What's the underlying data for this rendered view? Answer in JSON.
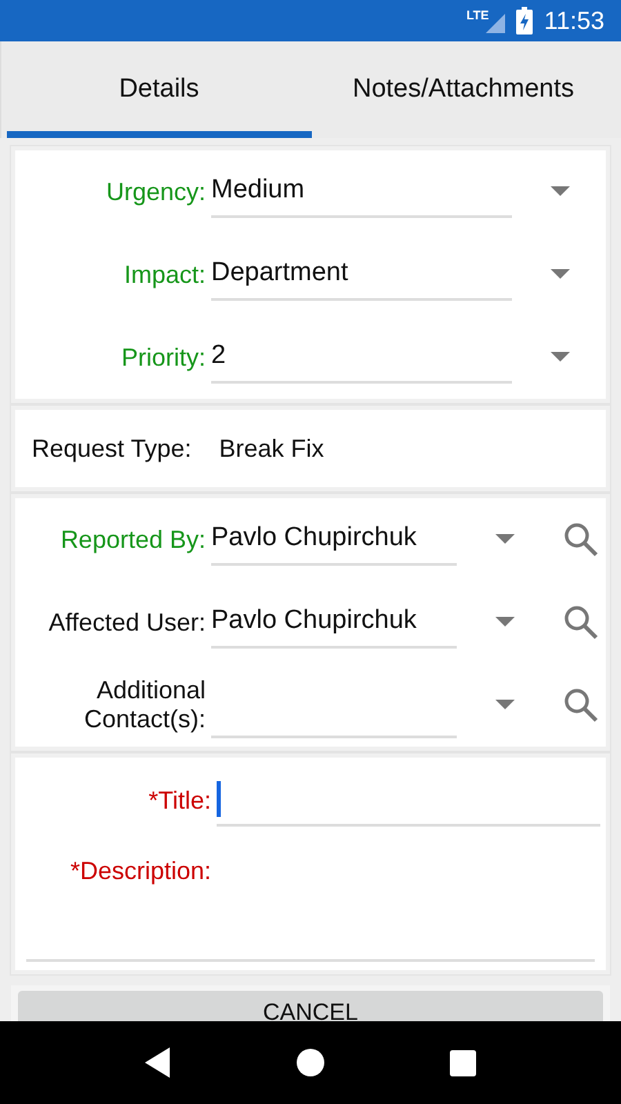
{
  "status_bar": {
    "network": "LTE",
    "time": "11:53"
  },
  "tabs": [
    {
      "label": "Details",
      "selected": true
    },
    {
      "label": "Notes/Attachments",
      "selected": false
    }
  ],
  "sections": [
    {
      "fields": [
        {
          "kind": "dropdown",
          "label": "Urgency:",
          "value": "Medium",
          "color": "#16961a"
        },
        {
          "kind": "dropdown",
          "label": "Impact:",
          "value": "Department",
          "color": "#16961a"
        },
        {
          "kind": "dropdown",
          "label": "Priority:",
          "value": "2",
          "color": "#16961a"
        }
      ]
    },
    {
      "fields": [
        {
          "kind": "static",
          "label": "Request Type:",
          "value": "Break Fix",
          "color": "#111111"
        }
      ]
    },
    {
      "fields": [
        {
          "kind": "lookup",
          "label": "Reported By:",
          "value": "Pavlo Chupirchuk",
          "color": "#16961a"
        },
        {
          "kind": "lookup",
          "label": "Affected User:",
          "value": "Pavlo Chupirchuk",
          "color": "#111111"
        },
        {
          "kind": "lookup",
          "label": "Additional Contact(s):",
          "color": "#111111"
        }
      ]
    },
    {
      "fields": [
        {
          "kind": "text",
          "label": "*Title:",
          "focused": true,
          "color": "#cc0000"
        },
        {
          "kind": "textarea",
          "label": "*Description:",
          "color": "#cc0000"
        }
      ]
    }
  ],
  "buttons": [
    {
      "label": "CANCEL"
    }
  ]
}
